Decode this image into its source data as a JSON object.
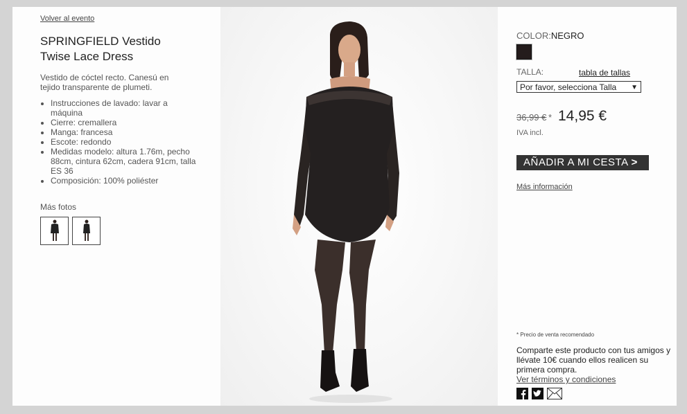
{
  "nav": {
    "back_label": "Volver al evento"
  },
  "product": {
    "title": "SPRINGFIELD Vestido Twise Lace Dress",
    "description": "Vestido de cóctel recto. Canesú en tejido transparente de plumeti.",
    "features": [
      "Instrucciones de lavado: lavar a máquina",
      "Cierre: cremallera",
      "Manga: francesa",
      "Escote: redondo",
      "Medidas modelo: altura 1.76m, pecho 88cm, cintura 62cm, cadera 91cm, talla ES 36",
      "Composición: 100% poliéster"
    ],
    "more_photos_label": "Más fotos"
  },
  "options": {
    "color_label": "COLOR:",
    "color_value": "NEGRO",
    "swatch_color": "#241c1c",
    "size_label": "TALLA:",
    "size_table_link": "tabla de tallas",
    "size_select_value": "Por favor, selecciona Talla"
  },
  "pricing": {
    "old_price": "36,99 €",
    "old_price_mark": "*",
    "new_price": "14,95 €",
    "vat_note": "IVA incl."
  },
  "actions": {
    "add_to_cart": "AÑADIR A MI CESTA",
    "add_to_cart_chevron": ">",
    "more_info": "Más información"
  },
  "footer": {
    "rrp_note": "* Precio de venta recomendado",
    "share_text": "Comparte este producto con tus amigos y llévate 10€ cuando ellos realicen su primera compra.",
    "terms_link": "Ver términos y condiciones",
    "share_icons": [
      "facebook-icon",
      "twitter-icon",
      "email-icon"
    ]
  }
}
